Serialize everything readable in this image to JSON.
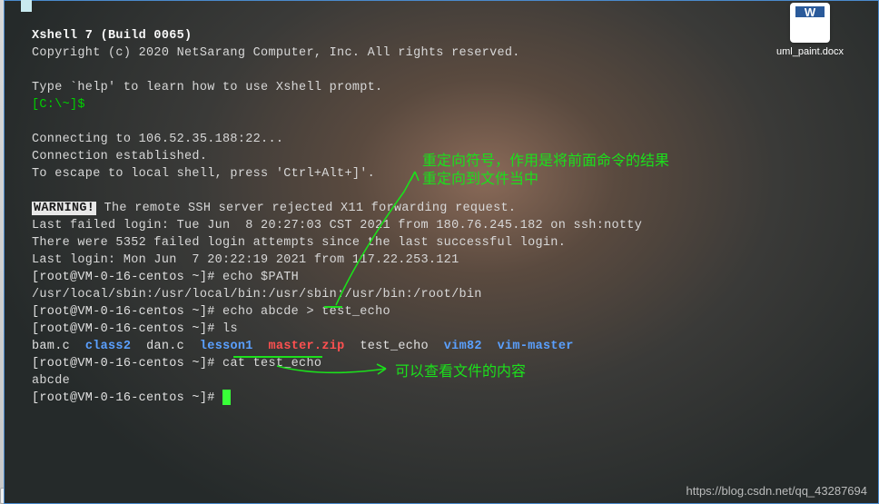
{
  "window": {
    "title_line": "Xshell 7 (Build 0065)",
    "copyright": "Copyright (c) 2020 NetSarang Computer, Inc. All rights reserved.",
    "help_line": "Type `help' to learn how to use Xshell prompt.",
    "local_prompt": "[C:\\~]$",
    "connecting": "Connecting to 106.52.35.188:22...",
    "established": "Connection established.",
    "escape_line": "To escape to local shell, press 'Ctrl+Alt+]'.",
    "warning_label": "WARNING!",
    "warning_rest": " The remote SSH server rejected X11 forwarding request.",
    "last_failed": "Last failed login: Tue Jun  8 20:27:03 CST 2021 from 180.76.245.182 on ssh:notty",
    "failed_attempts": "There were 5352 failed login attempts since the last successful login.",
    "last_login": "Last login: Mon Jun  7 20:22:19 2021 from 117.22.253.121",
    "prompt": "[root@VM-0-16-centos ~]# ",
    "cmd_echo_path": "echo $PATH",
    "path_value": "/usr/local/sbin:/usr/local/bin:/usr/sbin:/usr/bin:/root/bin",
    "cmd_echo_redirect": "echo abcde > test_echo",
    "cmd_ls": "ls",
    "cmd_cat": "cat test_echo",
    "cat_output": "abcde"
  },
  "ls_items": [
    {
      "name": "bam.c",
      "kind": "plain"
    },
    {
      "name": "class2",
      "kind": "dir"
    },
    {
      "name": "dan.c",
      "kind": "plain"
    },
    {
      "name": "lesson1",
      "kind": "dir"
    },
    {
      "name": "master.zip",
      "kind": "arch"
    },
    {
      "name": "test_echo",
      "kind": "plain"
    },
    {
      "name": "vim82",
      "kind": "dir"
    },
    {
      "name": "vim-master",
      "kind": "dir"
    }
  ],
  "annotations": {
    "redirect_line1": "重定向符号，作用是将前面命令的结果",
    "redirect_line2": "重定向到文件当中",
    "cat_note": "可以查看文件的内容"
  },
  "desktop": {
    "file_label": "uml_paint.docx",
    "doc_letter": "W"
  },
  "watermark": "https://blog.csdn.net/qq_43287694"
}
